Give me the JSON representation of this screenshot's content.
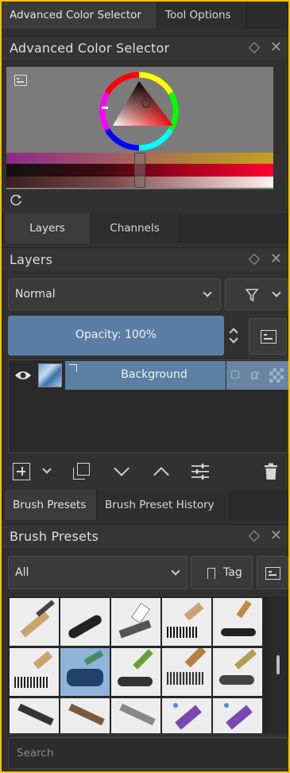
{
  "top_tabs": [
    "Advanced Color Selector",
    "Tool Options"
  ],
  "color_selector": {
    "title": "Advanced Color Selector"
  },
  "mid_tabs": [
    "Layers",
    "Channels"
  ],
  "layers": {
    "title": "Layers",
    "blend_mode": "Normal",
    "opacity_label": "Opacity:  100%",
    "items": [
      {
        "name": "Background"
      }
    ]
  },
  "bottom_tabs": [
    "Brush Presets",
    "Brush Preset History"
  ],
  "brush_presets": {
    "title": "Brush Presets",
    "filter_value": "All",
    "tag_label": "Tag",
    "search_placeholder": "Search"
  },
  "colors": {
    "accent_border": "#f2c200",
    "panel_bg": "#313131",
    "selection_blue": "#5c7fa3"
  }
}
